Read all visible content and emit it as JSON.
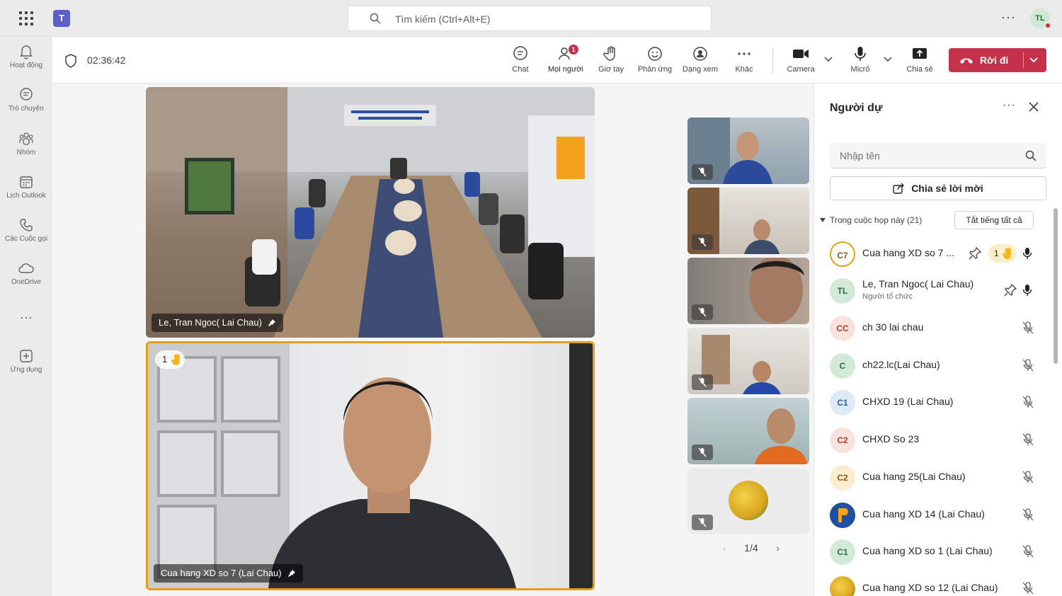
{
  "topbar": {
    "search_placeholder": "Tìm kiếm (Ctrl+Alt+E)",
    "user_initials": "TL"
  },
  "rail": {
    "items": [
      {
        "label": "Hoạt động",
        "icon": "bell-icon"
      },
      {
        "label": "Trò chuyện",
        "icon": "chat-icon"
      },
      {
        "label": "Nhóm",
        "icon": "teams-icon"
      },
      {
        "label": "Lịch Outlook",
        "icon": "calendar-icon"
      },
      {
        "label": "Các Cuộc gọi",
        "icon": "phone-icon"
      },
      {
        "label": "OneDrive",
        "icon": "cloud-icon"
      },
      {
        "label": "Ứng dụng",
        "icon": "add-app-icon"
      }
    ]
  },
  "meeting": {
    "timer": "02:36:42",
    "toolbar": {
      "chat": "Chat",
      "people": "Mọi người",
      "people_badge": "1",
      "raise_hand": "Giơ tay",
      "react": "Phản ứng",
      "view": "Dạng xem",
      "more": "Khác",
      "camera": "Camera",
      "mic": "Micrô",
      "share": "Chia sẻ",
      "leave": "Rời đi"
    }
  },
  "stage": {
    "tiles": [
      {
        "name": "Le, Tran Ngoc( Lai Chau)"
      },
      {
        "name": "Cua hang XD so 7 (Lai Chau)",
        "hand_count": "1"
      }
    ],
    "pager": "1/4"
  },
  "panel": {
    "title": "Người dự",
    "search_placeholder": "Nhập tên",
    "share_invite": "Chia sẻ lời mời",
    "section": "Trong cuộc họp này (21)",
    "mute_all": "Tắt tiếng tất cả",
    "participants": [
      {
        "initials": "C7",
        "name": "Cua hang XD so 7 ...",
        "hand": "1",
        "pinned": true,
        "mic_on": true
      },
      {
        "initials": "TL",
        "name": "Le, Tran Ngoc( Lai Chau)",
        "role": "Người tổ chức",
        "pinned": true,
        "mic_on": true
      },
      {
        "initials": "CC",
        "name": "ch 30 lai chau"
      },
      {
        "initials": "C",
        "name": "ch22.lc(Lai Chau)"
      },
      {
        "initials": "C1",
        "name": "CHXD 19 (Lai Chau)"
      },
      {
        "initials": "C2",
        "name": "CHXD So 23"
      },
      {
        "initials": "C2",
        "name": "Cua hang 25(Lai Chau)"
      },
      {
        "initials": "",
        "name": "Cua hang XD 14 (Lai Chau)"
      },
      {
        "initials": "C1",
        "name": "Cua hang XD so 1 (Lai Chau)"
      },
      {
        "initials": "",
        "name": "Cua hang XD so 12 (Lai Chau)"
      }
    ]
  },
  "colors": {
    "accent": "#5b5fc7",
    "leave": "#c4314b",
    "active_speaker_border": "#e0a21a"
  }
}
